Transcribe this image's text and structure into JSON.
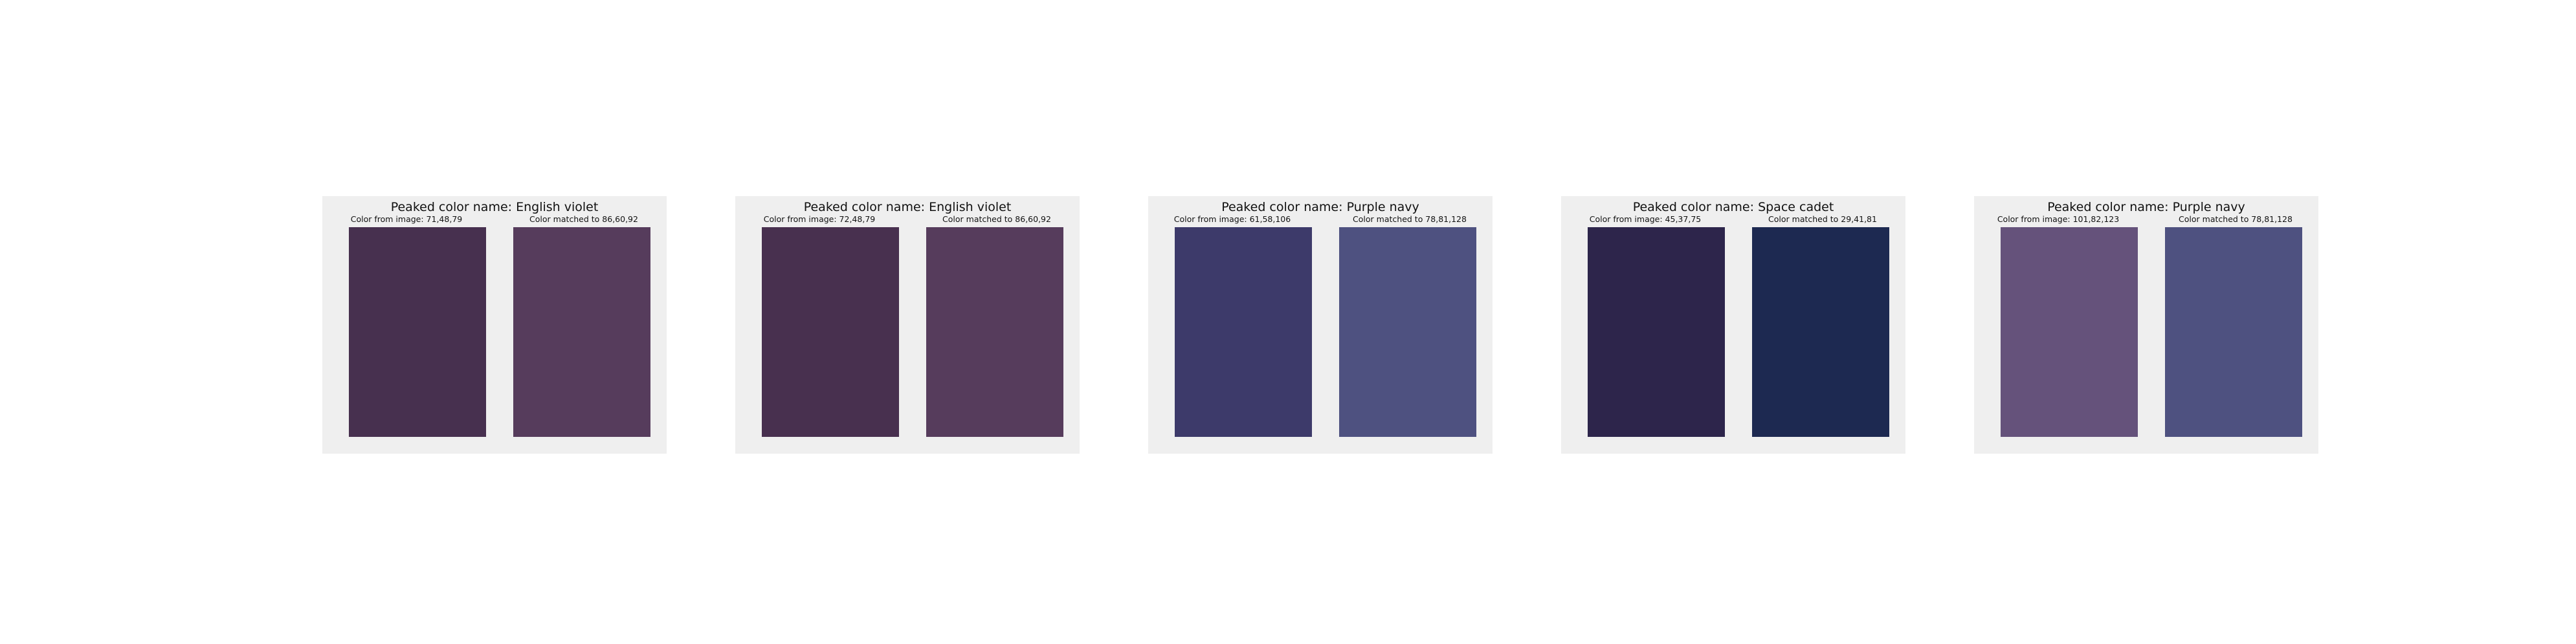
{
  "panels": [
    {
      "title": "Peaked color name: English violet",
      "image_label": "Color from image: 71,48,79",
      "match_label": "Color matched to 86,60,92",
      "image_color": "#47304f",
      "match_color": "#563c5c"
    },
    {
      "title": "Peaked color name: English violet",
      "image_label": "Color from image: 72,48,79",
      "match_label": "Color matched to 86,60,92",
      "image_color": "#48304f",
      "match_color": "#563c5c"
    },
    {
      "title": "Peaked color name: Purple navy",
      "image_label": "Color from image: 61,58,106",
      "match_label": "Color matched to 78,81,128",
      "image_color": "#3d3a6a",
      "match_color": "#4e5180"
    },
    {
      "title": "Peaked color name: Space cadet",
      "image_label": "Color from image: 45,37,75",
      "match_label": "Color matched to 29,41,81",
      "image_color": "#2d254b",
      "match_color": "#1d2951"
    },
    {
      "title": "Peaked color name: Purple navy",
      "image_label": "Color from image: 101,82,123",
      "match_label": "Color matched to 78,81,128",
      "image_color": "#65527b",
      "match_color": "#4e5180"
    }
  ]
}
